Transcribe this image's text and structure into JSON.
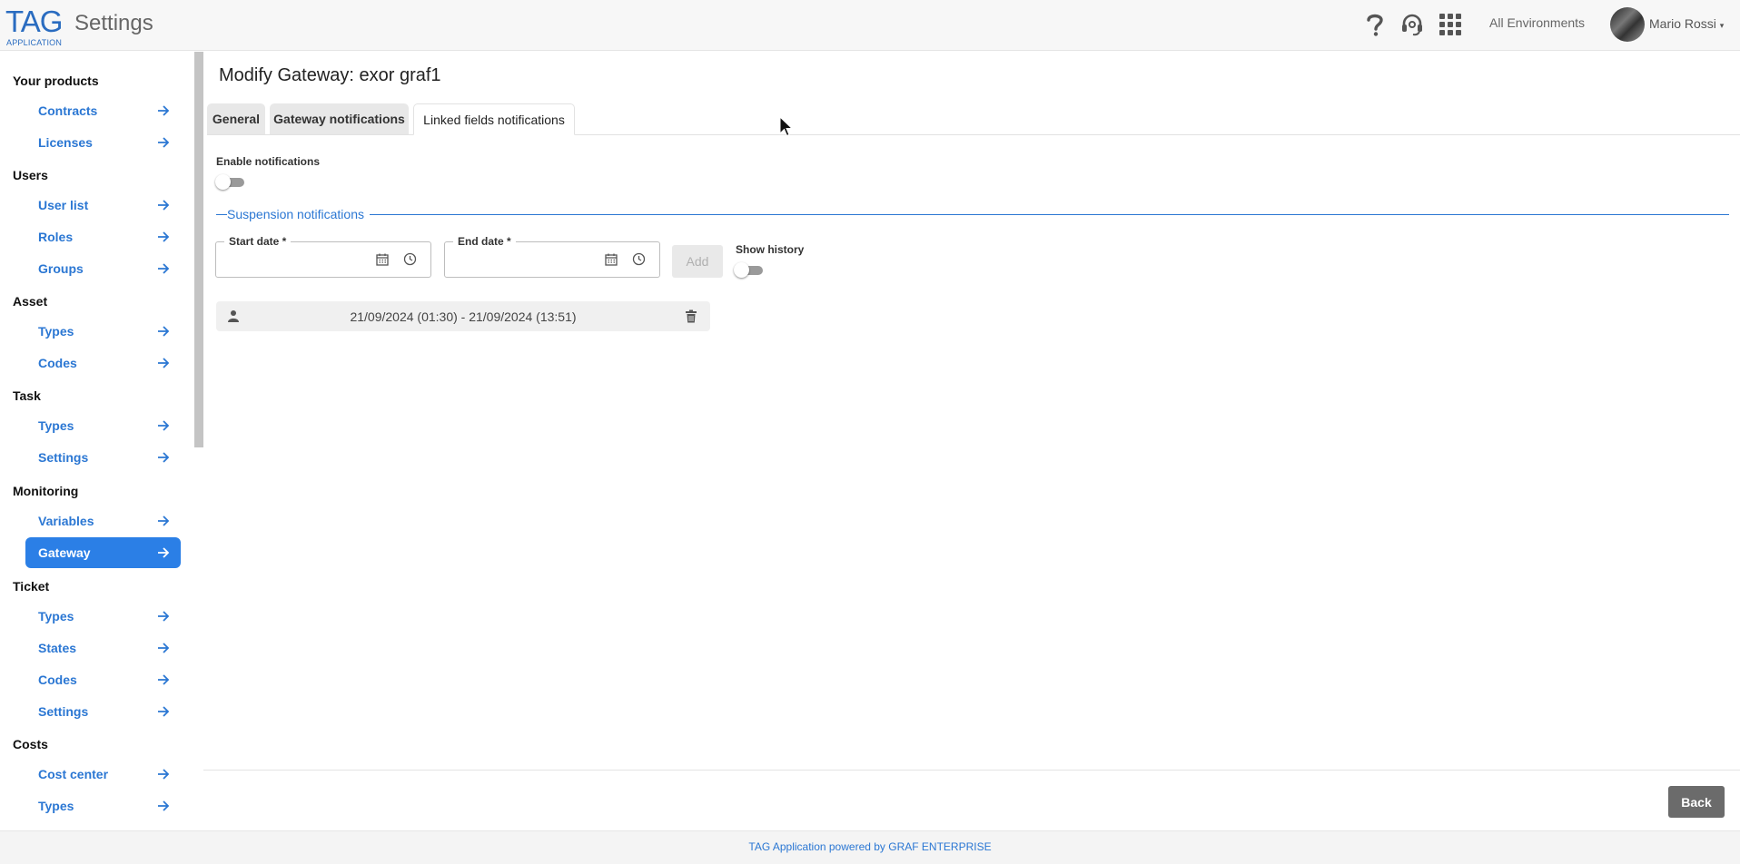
{
  "header": {
    "logo_text": "TAG",
    "logo_sub": "APPLICATION",
    "title": "Settings",
    "environment": "All Environments",
    "user_name": "Mario Rossi",
    "icons": [
      "help-icon",
      "headset-icon",
      "apps-grid-icon"
    ]
  },
  "sidebar": {
    "sections": [
      {
        "title": "Your products",
        "items": [
          "Contracts",
          "Licenses"
        ]
      },
      {
        "title": "Users",
        "items": [
          "User list",
          "Roles",
          "Groups"
        ]
      },
      {
        "title": "Asset",
        "items": [
          "Types",
          "Codes"
        ]
      },
      {
        "title": "Task",
        "items": [
          "Types",
          "Settings"
        ]
      },
      {
        "title": "Monitoring",
        "items": [
          "Variables",
          "Gateway"
        ]
      },
      {
        "title": "Ticket",
        "items": [
          "Types",
          "States",
          "Codes",
          "Settings"
        ]
      },
      {
        "title": "Costs",
        "items": [
          "Cost center",
          "Types"
        ]
      }
    ],
    "active_item": "Gateway"
  },
  "main": {
    "page_title": "Modify Gateway: exor graf1",
    "tabs": [
      {
        "label": "General",
        "active": false
      },
      {
        "label": "Gateway notifications",
        "active": false
      },
      {
        "label": "Linked fields notifications",
        "active": true
      }
    ],
    "enable_notifications_label": "Enable notifications",
    "enable_notifications_on": false,
    "suspension_title": "Suspension notifications",
    "start_date_label": "Start date *",
    "start_date_value": "",
    "end_date_label": "End date *",
    "end_date_value": "",
    "add_label": "Add",
    "show_history_label": "Show history",
    "show_history_on": false,
    "suspensions": [
      {
        "range": "21/09/2024 (01:30) - 21/09/2024 (13:51)"
      }
    ],
    "back_label": "Back"
  },
  "footer": {
    "text": "TAG Application powered by GRAF ENTERPRISE"
  },
  "colors": {
    "accent": "#2b77d3",
    "active_item_bg": "#2b7fe6",
    "back_button": "#6b6b6b"
  }
}
